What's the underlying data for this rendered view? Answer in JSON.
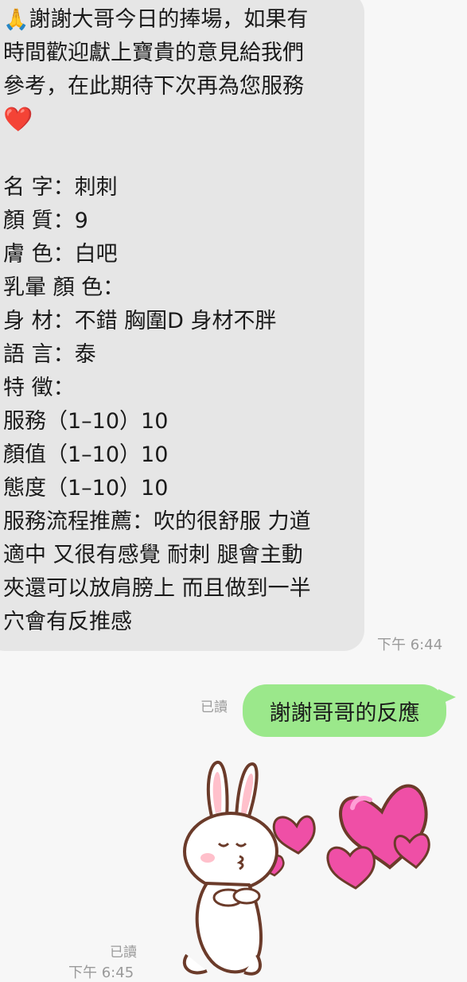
{
  "incoming": {
    "emoji_pray": "🙏",
    "emoji_heart": "❤️",
    "lines": [
      "謝謝大哥今日的捧場，如果有",
      "時間歡迎獻上寶貴的意見給我們",
      "參考，在此期待下次再為您服務",
      "",
      "",
      "名 字：刺刺",
      "顏 質：9",
      "膚 色：白吧",
      "乳暈 顏 色：",
      "身 材：不錯 胸圍D 身材不胖",
      "語 言：泰",
      "特 徵：",
      "服務（1–10）10",
      "顏值（1–10）10",
      "態度（1–10）10",
      "服務流程推薦：吹的很舒服 力道",
      "適中 又很有感覺 耐刺 腿會主動",
      "夾還可以放肩膀上 而且做到一半",
      "穴會有反推感"
    ],
    "time": "下午 6:44"
  },
  "outgoing": {
    "read": "已讀",
    "text": "謝謝哥哥的反應"
  },
  "sticker": {
    "read": "已讀",
    "time": "下午 6:45",
    "colors": {
      "heart": "#ef4fa6",
      "heart_light": "#ff8fcf",
      "outline": "#6b3b2a",
      "ear": "#ffc0cb"
    }
  }
}
